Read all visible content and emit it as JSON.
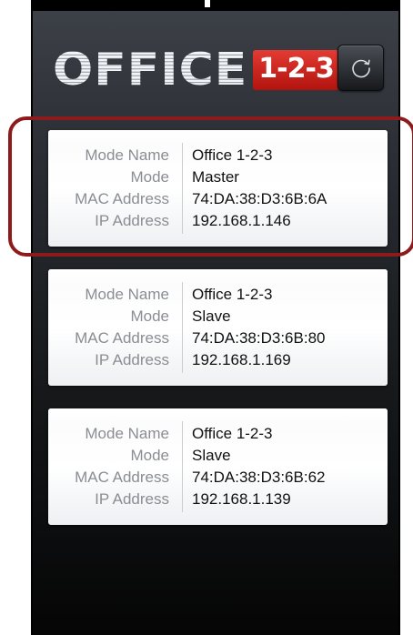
{
  "header": {
    "logo_word": "OFFICE",
    "logo_badge": "1-2-3",
    "refresh_icon": "refresh-icon"
  },
  "devices": [
    {
      "mode_name_label": "Mode Name",
      "mode_name": "Office 1-2-3",
      "mode_label": "Mode",
      "mode": "Master",
      "mac_label": "MAC Address",
      "mac": "74:DA:38:D3:6B:6A",
      "ip_label": "IP Address",
      "ip": "192.168.1.146"
    },
    {
      "mode_name_label": "Mode Name",
      "mode_name": "Office 1-2-3",
      "mode_label": "Mode",
      "mode": "Slave",
      "mac_label": "MAC Address",
      "mac": "74:DA:38:D3:6B:80",
      "ip_label": "IP Address",
      "ip": "192.168.1.169"
    },
    {
      "mode_name_label": "Mode Name",
      "mode_name": "Office 1-2-3",
      "mode_label": "Mode",
      "mode": "Slave",
      "mac_label": "MAC Address",
      "mac": "74:DA:38:D3:6B:62",
      "ip_label": "IP Address",
      "ip": "192.168.1.139"
    }
  ],
  "colors": {
    "highlight": "#8e1b1b",
    "badge": "#c8211a"
  }
}
